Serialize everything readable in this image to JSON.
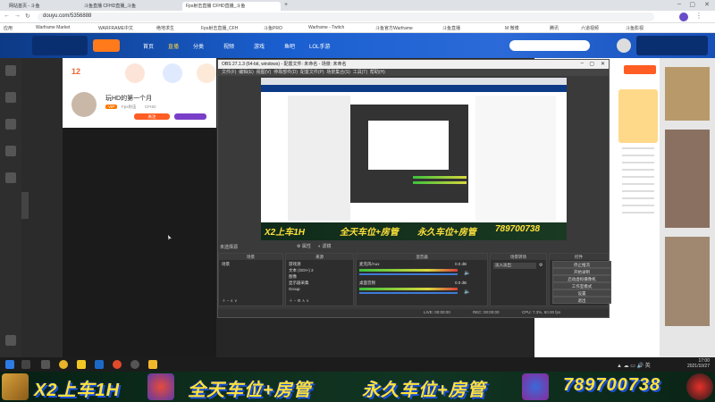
{
  "browser": {
    "tabs": [
      {
        "label": "网站首页 - 斗鱼"
      },
      {
        "label": "斗鱼直播 CFHD直播_斗鱼"
      },
      {
        "label": "Fps射击直播 CFHD直播_斗鱼"
      }
    ],
    "url": "douyu.com/5356888",
    "bookmarks": [
      "应用",
      "Warframe Market",
      "WARFRAME中文",
      "绝地求生",
      "Fps射击直播_CFH",
      "斗鱼PRO",
      "Warframe - Twitch",
      "斗鱼官方Warframe",
      "斗鱼直播",
      "M 微博",
      "腾讯",
      "六道视频",
      "斗鱼影视"
    ]
  },
  "site": {
    "nav": [
      "首页",
      "直播",
      "分类",
      "视频",
      "游戏",
      "鱼吧",
      "LOL手游"
    ],
    "nav_active": "直播"
  },
  "room": {
    "rank_number": "12",
    "title": "玩HD的第一个月",
    "tags": [
      "VIP",
      "Fps射击",
      "CFHD",
      "直播间"
    ],
    "follow_label": "关注"
  },
  "obs": {
    "title": "OBS 27.1.3 (64-bit, windows) - 配置文件: 未命名 - 场景: 未命名",
    "menu": [
      "文件(F)",
      "编辑(E)",
      "视图(V)",
      "停靠部件(D)",
      "配置文件(P)",
      "场景集合(S)",
      "工具(T)",
      "帮助(H)"
    ],
    "no_source": "未选择源",
    "props_label": "属性",
    "filters_label": "滤镜",
    "panels": {
      "scenes": {
        "header": "场景",
        "items": [
          "场景"
        ]
      },
      "sources": {
        "header": "来源",
        "items": [
          "游戏源",
          "文本 (GDI+) 2",
          "图像",
          "显示器采集",
          "Group"
        ]
      },
      "mixer": {
        "header": "混音器",
        "channels": [
          {
            "name": "麦克风/Aux",
            "db": "0.0 dB"
          },
          {
            "name": "桌面音频",
            "db": "0.0 dB"
          }
        ]
      },
      "transitions": {
        "header": "场景转场",
        "value": "淡入淡出",
        "duration_label": "时长 300 ms"
      },
      "controls": {
        "header": "控件",
        "buttons": [
          "停止推流",
          "开始录制",
          "启动虚拟摄像机",
          "工作室模式",
          "设置",
          "退出"
        ]
      }
    },
    "status": {
      "live": "LIVE: 00:00:00",
      "rec": "REC: 00:00:00",
      "cpu": "CPU: 7.3%, 60.00 fps"
    }
  },
  "taskbar": {
    "time": "17:00",
    "date": "2021/10/27"
  },
  "banner": {
    "segments": [
      "X2上车1H",
      "全天车位+房管",
      "永久车位+房管",
      "789700738"
    ]
  },
  "colors": {
    "site_blue": "#1a5fd0",
    "banner_yellow": "#ffe23a",
    "banner_bg": "#0e2e1c",
    "obs_dark": "#2d2d2d"
  }
}
